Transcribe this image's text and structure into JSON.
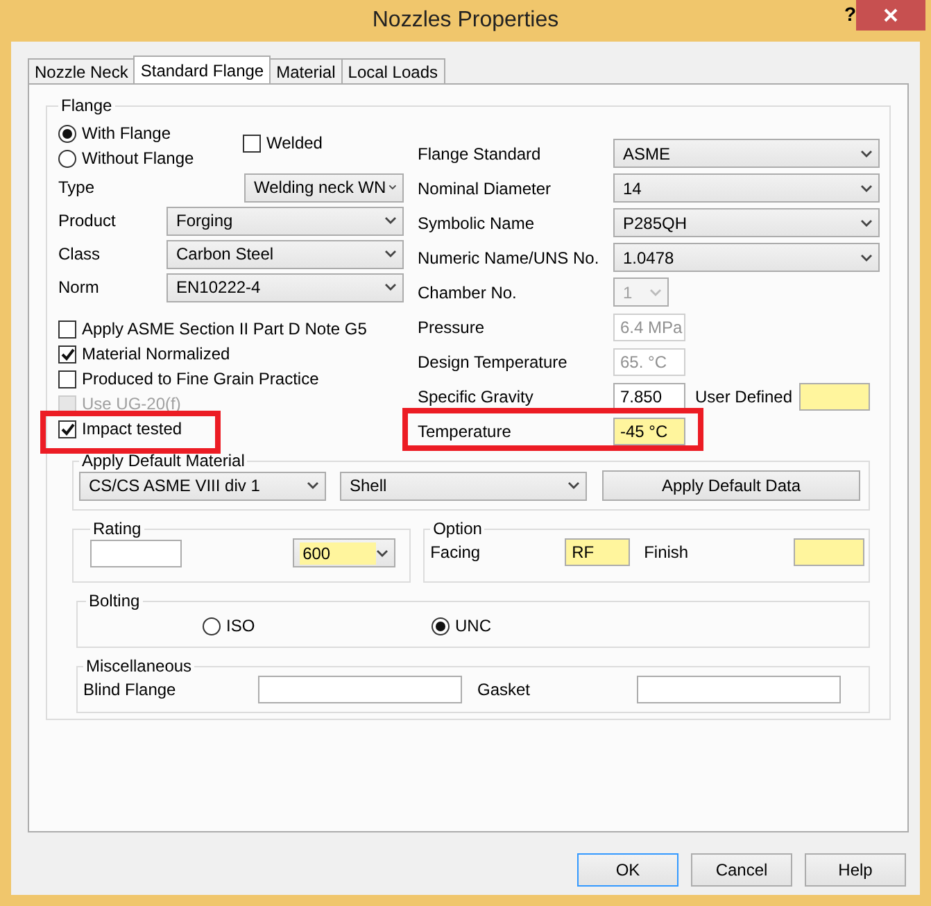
{
  "window": {
    "title": "Nozzles Properties",
    "help_button": "?"
  },
  "tabs": [
    {
      "label": "Nozzle Neck",
      "selected": false
    },
    {
      "label": "Standard Flange",
      "selected": true
    },
    {
      "label": "Material",
      "selected": false
    },
    {
      "label": "Local Loads",
      "selected": false
    }
  ],
  "flange": {
    "label": "Flange",
    "mounting": [
      {
        "label": "With Flange",
        "selected": true
      },
      {
        "label": "Without Flange",
        "selected": false
      }
    ],
    "welded": {
      "label": "Welded",
      "checked": false
    },
    "left_fields": [
      {
        "label": "Type",
        "value": "Welding neck WN",
        "wide": false
      },
      {
        "label": "Product",
        "value": "Forging",
        "wide": true
      },
      {
        "label": "Class",
        "value": "Carbon Steel",
        "wide": true
      },
      {
        "label": "Norm",
        "value": "EN10222-4",
        "wide": true
      }
    ],
    "checkboxes": [
      {
        "label": "Apply ASME Section II Part D Note G5",
        "checked": false,
        "disabled": false,
        "highlighted": false
      },
      {
        "label": "Material Normalized",
        "checked": true,
        "disabled": false,
        "highlighted": false
      },
      {
        "label": "Produced to Fine Grain Practice",
        "checked": false,
        "disabled": false,
        "highlighted": false
      },
      {
        "label": "Use UG-20(f)",
        "checked": false,
        "disabled": true,
        "highlighted": false
      },
      {
        "label": "Impact tested",
        "checked": true,
        "disabled": false,
        "highlighted": true
      }
    ],
    "right_fields": [
      {
        "label": "Flange Standard",
        "kind": "dropdown",
        "value": "ASME",
        "disabled": false,
        "emphasized": false,
        "highlighted": false
      },
      {
        "label": "Nominal Diameter",
        "kind": "dropdown",
        "value": "14",
        "disabled": false,
        "emphasized": false,
        "highlighted": false
      },
      {
        "label": "Symbolic Name",
        "kind": "dropdown",
        "value": "P285QH",
        "disabled": false,
        "emphasized": false,
        "highlighted": false
      },
      {
        "label": "Numeric Name/UNS No.",
        "kind": "dropdown",
        "value": "1.0478",
        "disabled": false,
        "emphasized": false,
        "highlighted": false
      },
      {
        "label": "Chamber No.",
        "kind": "small_dropdown",
        "value": "1",
        "disabled": true,
        "emphasized": false,
        "highlighted": false
      },
      {
        "label": "Pressure",
        "kind": "text",
        "value": "6.4 MPa",
        "disabled": true,
        "emphasized": false,
        "highlighted": false
      },
      {
        "label": "Design Temperature",
        "kind": "text",
        "value": "65. °C",
        "disabled": true,
        "emphasized": false,
        "highlighted": false
      },
      {
        "label": "Specific Gravity",
        "kind": "text",
        "value": "7.850",
        "disabled": false,
        "emphasized": false,
        "highlighted": false,
        "extra": {
          "label": "User Defined",
          "emphasized": true
        }
      },
      {
        "label": "Temperature",
        "kind": "text",
        "value": "-45 °C",
        "disabled": false,
        "emphasized": true,
        "highlighted": true
      }
    ],
    "default_material": {
      "label": "Apply Default Material",
      "dropdowns": [
        "CS/CS ASME VIII div 1",
        "Shell"
      ],
      "button": "Apply Default Data"
    },
    "rating": {
      "label": "Rating",
      "value": "600",
      "emphasized": true
    },
    "option": {
      "label": "Option",
      "facing_label": "Facing",
      "facing": "RF",
      "facing_emphasized": true,
      "finish_label": "Finish",
      "finish_emphasized": true
    },
    "bolting": {
      "label": "Bolting",
      "options": [
        {
          "label": "ISO",
          "selected": false
        },
        {
          "label": "UNC",
          "selected": true
        }
      ]
    },
    "miscellaneous": {
      "label": "Miscellaneous",
      "fields": [
        {
          "label": "Blind Flange"
        },
        {
          "label": "Gasket"
        }
      ]
    }
  },
  "buttons": [
    {
      "label": "OK",
      "default": true
    },
    {
      "label": "Cancel",
      "default": false
    },
    {
      "label": "Help",
      "default": false
    }
  ]
}
